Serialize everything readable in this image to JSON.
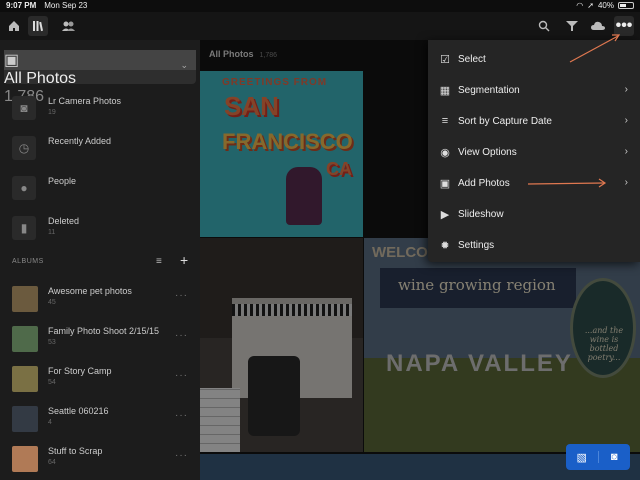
{
  "status_bar": {
    "time": "9:07 PM",
    "date": "Mon Sep 23",
    "battery": "40%"
  },
  "sidebar": {
    "selected": {
      "name": "All Photos",
      "count": "1,786"
    },
    "items": [
      {
        "name": "Lr Camera Photos",
        "count": "19",
        "icon": "camera-icon"
      },
      {
        "name": "Recently Added",
        "count": "",
        "icon": "clock-icon"
      },
      {
        "name": "People",
        "count": "",
        "icon": "person-icon"
      },
      {
        "name": "Deleted",
        "count": "11",
        "icon": "trash-icon"
      }
    ],
    "albums_header": "ALBUMS",
    "albums": [
      {
        "name": "Awesome pet photos",
        "count": "45",
        "color": "#6b5a3e"
      },
      {
        "name": "Family Photo Shoot 2/15/15",
        "count": "53",
        "color": "#4f6a4a"
      },
      {
        "name": "For Story Camp",
        "count": "54",
        "color": "#7a7044"
      },
      {
        "name": "Seattle 060216",
        "count": "4",
        "color": "#333a44"
      },
      {
        "name": "Stuff to Scrap",
        "count": "64",
        "color": "#b07a56"
      }
    ],
    "more_label": "···"
  },
  "main": {
    "title": "All Photos",
    "count": "1,786",
    "photo1": {
      "header": "GREETINGS FROM",
      "line1": "SAN",
      "line2": "FRANCISCO",
      "line3": "CA"
    },
    "photo3": {
      "welcome": "WELCO",
      "sign": "wine growing region",
      "napa": "NAPA VALLEY",
      "oval": "...and the wine is bottled poetry..."
    }
  },
  "menu": {
    "items": [
      {
        "label": "Select",
        "icon": "checkbox-icon",
        "arrow": ""
      },
      {
        "label": "Segmentation",
        "icon": "segments-icon",
        "arrow": "›"
      },
      {
        "label": "Sort by Capture Date",
        "icon": "sort-icon",
        "arrow": "›"
      },
      {
        "label": "View Options",
        "icon": "eye-icon",
        "arrow": "›"
      },
      {
        "label": "Add Photos",
        "icon": "add-photo-icon",
        "arrow": "›"
      },
      {
        "label": "Slideshow",
        "icon": "play-icon",
        "arrow": ""
      },
      {
        "label": "Settings",
        "icon": "gear-icon",
        "arrow": ""
      }
    ]
  },
  "colors": {
    "accent": "#1a5fc8",
    "annotation": "#e07850"
  }
}
